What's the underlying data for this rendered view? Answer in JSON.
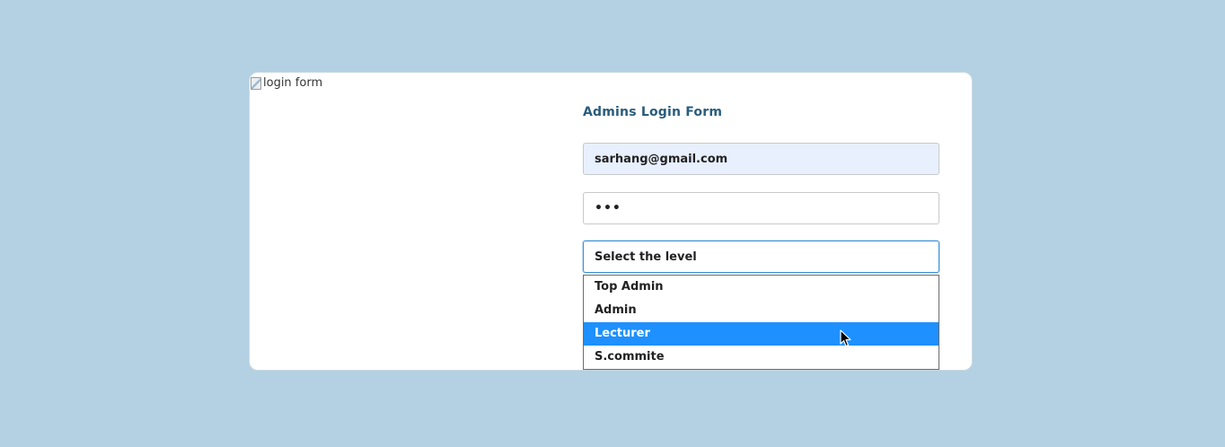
{
  "login_image": {
    "alt_text": "login form"
  },
  "form": {
    "title": "Admins Login Form",
    "email_value": "sarhang@gmail.com",
    "password_value": "•••",
    "level_select": {
      "selected_label": "Select the level",
      "options": [
        "Top Admin",
        "Admin",
        "Lecturer",
        "S.commite"
      ],
      "highlighted_option": "Lecturer"
    }
  },
  "colors": {
    "page_background": "#b3d1e2",
    "title": "#2a5c7c",
    "highlight": "#1e90ff",
    "autofill": "#e8f0fe"
  }
}
